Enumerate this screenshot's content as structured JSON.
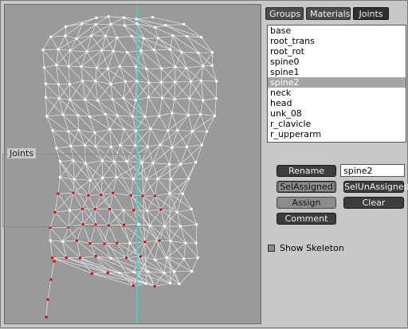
{
  "tabs": [
    {
      "label": "Groups",
      "active": false
    },
    {
      "label": "Materials",
      "active": false
    },
    {
      "label": "Joints",
      "active": true
    }
  ],
  "joints": {
    "items": [
      "base",
      "root_trans",
      "root_rot",
      "spine0",
      "spine1",
      "spine2",
      "neck",
      "head",
      "unk_08",
      "r_clavicle",
      "r_upperarm"
    ],
    "selected": "spine2",
    "group_label": "Joints",
    "rename_label": "Rename",
    "name_value": "spine2",
    "sel_assigned_label": "SelAssigned",
    "sel_unassigned_label": "SelUnAssigned",
    "assign_label": "Assign",
    "clear_label": "Clear",
    "comment_label": "Comment"
  },
  "options": {
    "show_skeleton_label": "Show Skeleton",
    "show_skeleton_checked": true
  },
  "colors": {
    "vertex": "#ffffff",
    "assigned_vertex": "#dd0000",
    "axis_line": "#39d8d8",
    "viewport_bg": "#9a9a9a"
  }
}
